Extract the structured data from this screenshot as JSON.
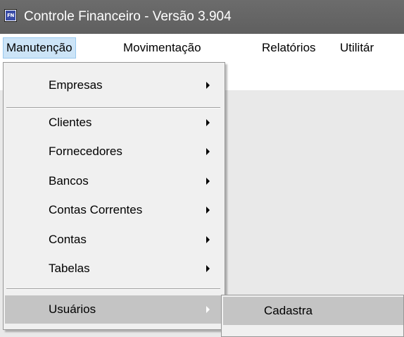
{
  "window": {
    "icon_text": "FN",
    "title": "Controle Financeiro - Versão 3.904"
  },
  "menubar": {
    "items": [
      {
        "label": "Manutenção",
        "active": true
      },
      {
        "label": "Movimentação"
      },
      {
        "label": "Relatórios"
      },
      {
        "label": "Utilitár"
      }
    ]
  },
  "dropdown": {
    "items": [
      {
        "label": "Empresas",
        "has_submenu": true
      },
      {
        "label": "Clientes",
        "has_submenu": true
      },
      {
        "label": "Fornecedores",
        "has_submenu": true
      },
      {
        "label": "Bancos",
        "has_submenu": true
      },
      {
        "label": "Contas Correntes",
        "has_submenu": true
      },
      {
        "label": "Contas",
        "has_submenu": true
      },
      {
        "label": "Tabelas",
        "has_submenu": true
      },
      {
        "label": "Usuários",
        "has_submenu": true,
        "highlighted": true
      }
    ]
  },
  "submenu": {
    "items": [
      {
        "label": "Cadastra",
        "highlighted": true
      }
    ]
  },
  "colors": {
    "titlebar": "#666666",
    "menu_background": "#f0f0f0",
    "highlight": "#c4c4c4",
    "menubar_active": "#cce4f7"
  }
}
